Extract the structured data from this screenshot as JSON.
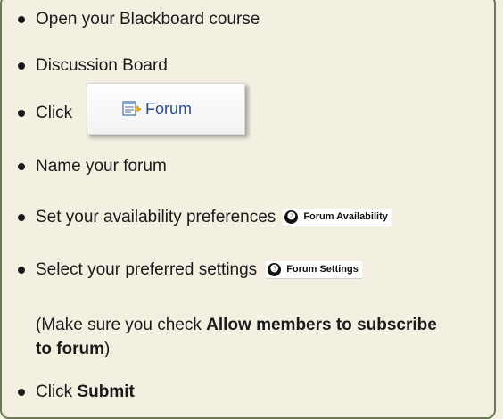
{
  "items": {
    "open_course": "Open your Blackboard course",
    "discussion_board": "Discussion Board",
    "click_prefix": "Click",
    "name_forum": "Name your forum",
    "availability": "Set your availability preferences",
    "settings": "Select your preferred settings",
    "note_prefix": "(Make sure you check ",
    "note_bold": "Allow members to subscribe to forum",
    "note_suffix": ")",
    "submit_prefix": "Click ",
    "submit_bold": "Submit"
  },
  "forum_button": {
    "icon": "forum-add-icon",
    "label": "Forum"
  },
  "badges": {
    "availability_num": "❷",
    "availability_label": "Forum Availability",
    "settings_num": "❸",
    "settings_label": "Forum Settings"
  },
  "colors": {
    "background": "#f3f0e1",
    "frame": "#6b7a55",
    "link_blue": "#2a4a8c"
  }
}
